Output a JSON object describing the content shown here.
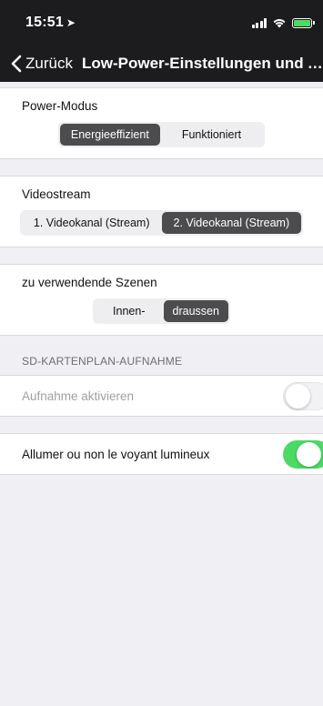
{
  "status_bar": {
    "time": "15:51"
  },
  "nav": {
    "back_label": "Zurück",
    "title": "Low-Power-Einstellungen und Aufnahme"
  },
  "power_mode": {
    "label": "Power-Modus",
    "options": [
      "Energieeffizient",
      "Funktioniert"
    ],
    "selected_index": 0
  },
  "videostream": {
    "label": "Videostream",
    "options": [
      "1. Videokanal (Stream)",
      "2. Videokanal (Stream)"
    ],
    "selected_index": 1
  },
  "scenes": {
    "label": "zu verwendende Szenen",
    "options": [
      "Innen-",
      "draussen"
    ],
    "selected_index": 1
  },
  "sd_card": {
    "header": "SD-KARTENPLAN-AUFNAHME",
    "record_label": "Aufnahme aktivieren",
    "record_enabled": false
  },
  "indicator": {
    "label": "Allumer ou non le voyant lumineux",
    "enabled": true
  },
  "colors": {
    "accent_green": "#4cd964",
    "segment_active": "#4c4c4e",
    "nav_background": "#1c1c1e"
  }
}
